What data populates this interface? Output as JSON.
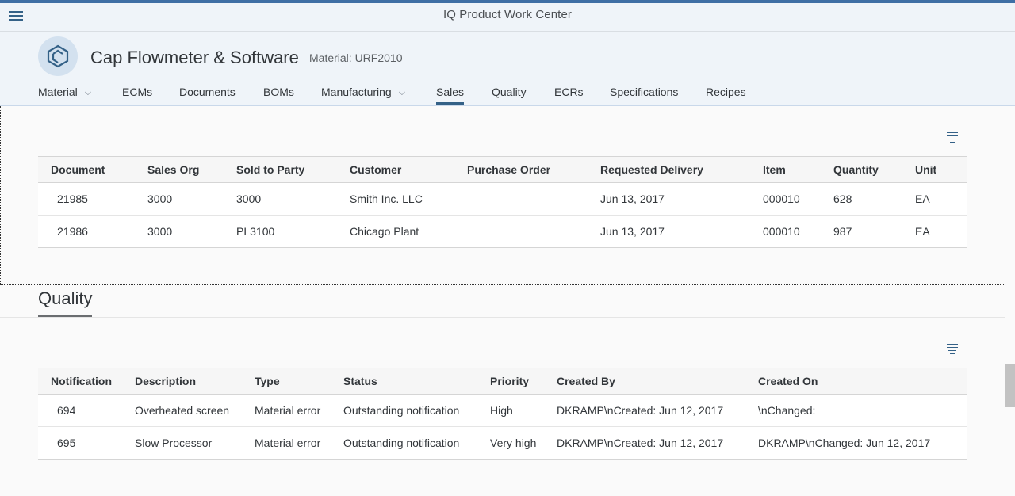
{
  "shell": {
    "app_title": "IQ Product Work Center"
  },
  "header": {
    "title": "Cap Flowmeter & Software",
    "material_label": "Material: URF2010",
    "icon": "cube-icon"
  },
  "nav": {
    "tabs": [
      {
        "label": "Material",
        "has_dropdown": true
      },
      {
        "label": "ECMs"
      },
      {
        "label": "Documents"
      },
      {
        "label": "BOMs"
      },
      {
        "label": "Manufacturing",
        "has_dropdown": true
      },
      {
        "label": "Sales",
        "selected": true
      },
      {
        "label": "Quality"
      },
      {
        "label": "ECRs"
      },
      {
        "label": "Specifications"
      },
      {
        "label": "Recipes"
      }
    ],
    "chevron": "⌵"
  },
  "sales": {
    "columns": [
      "Document",
      "Sales Org",
      "Sold to Party",
      "Customer",
      "Purchase Order",
      "Requested Delivery",
      "Item",
      "Quantity",
      "Unit"
    ],
    "rows": [
      {
        "document": "21985",
        "sales_org": "3000",
        "sold_to_party": "3000",
        "customer": "Smith Inc. LLC",
        "purchase_order": "",
        "requested_delivery": "Jun 13, 2017",
        "item": "000010",
        "quantity": "628",
        "unit": "EA"
      },
      {
        "document": "21986",
        "sales_org": "3000",
        "sold_to_party": "PL3100",
        "customer": "Chicago Plant",
        "purchase_order": "",
        "requested_delivery": "Jun 13, 2017",
        "item": "000010",
        "quantity": "987",
        "unit": "EA"
      }
    ]
  },
  "quality": {
    "heading": "Quality",
    "columns": [
      "Notification",
      "Description",
      "Type",
      "Status",
      "Priority",
      "Created By",
      "Created On"
    ],
    "rows": [
      {
        "notification": "694",
        "description": "Overheated screen",
        "type": "Material error",
        "status": "Outstanding notification",
        "priority": "High",
        "created_by": "DKRAMP\\nCreated: Jun 12, 2017",
        "created_on": "\\nChanged:"
      },
      {
        "notification": "695",
        "description": "Slow Processor",
        "type": "Material error",
        "status": "Outstanding notification",
        "priority": "Very high",
        "created_by": "DKRAMP\\nCreated: Jun 12, 2017",
        "created_on": "DKRAMP\\nChanged: Jun 12, 2017"
      }
    ]
  },
  "colors": {
    "accent": "#346187",
    "shell_bar": "#3f6fa5",
    "priority_high": "#bb0000"
  }
}
